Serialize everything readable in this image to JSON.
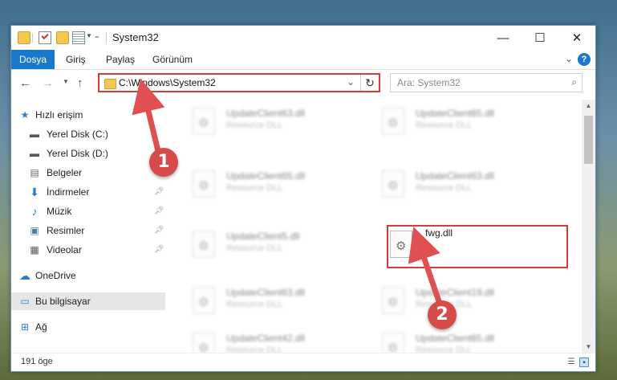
{
  "window": {
    "title": "System32",
    "minimize_glyph": "—",
    "maximize_glyph": "☐",
    "close_glyph": "✕"
  },
  "ribbon": {
    "tabs": [
      {
        "label": "Dosya"
      },
      {
        "label": "Giriş"
      },
      {
        "label": "Paylaş"
      },
      {
        "label": "Görünüm"
      }
    ],
    "help": "?"
  },
  "navbar": {
    "back": "←",
    "forward": "→",
    "up": "↑",
    "address": "C:\\Windows\\System32",
    "search_placeholder": "Ara: System32"
  },
  "sidebar": {
    "items": [
      {
        "label": "Hızlı erişim",
        "icon": "star-icon"
      },
      {
        "label": "Yerel Disk (C:)",
        "icon": "drive-icon"
      },
      {
        "label": "Yerel Disk (D:)",
        "icon": "drive-icon"
      },
      {
        "label": "Belgeler",
        "icon": "document-icon"
      },
      {
        "label": "İndirmeler",
        "icon": "download-icon"
      },
      {
        "label": "Müzik",
        "icon": "music-icon"
      },
      {
        "label": "Resimler",
        "icon": "pictures-icon"
      },
      {
        "label": "Videolar",
        "icon": "video-icon"
      },
      {
        "label": "OneDrive",
        "icon": "cloud-icon"
      },
      {
        "label": "Bu bilgisayar",
        "icon": "computer-icon"
      },
      {
        "label": "Ağ",
        "icon": "network-icon"
      }
    ]
  },
  "files": [
    {
      "name": "UpdateClient63.dll",
      "type": "Resource DLL"
    },
    {
      "name": "UpdateClient65.dll",
      "type": "Resource DLL"
    },
    {
      "name": "UpdateClient65.dll",
      "type": "Resource DLL"
    },
    {
      "name": "UpdateClient63.dll",
      "type": "Resource DLL"
    },
    {
      "name": "UpdateClient5.dll",
      "type": "Resource DLL"
    },
    {
      "name": "fwg.dll",
      "type": ""
    },
    {
      "name": "UpdateClient63.dll",
      "type": "Resource DLL"
    },
    {
      "name": "UpdateClient19.dll",
      "type": "Resource DLL"
    },
    {
      "name": "UpdateClient42.dll",
      "type": "Resource DLL"
    },
    {
      "name": "UpdateClient65.dll",
      "type": "Resource DLL"
    }
  ],
  "status": {
    "count": "191 öge"
  },
  "callouts": [
    "1",
    "2"
  ],
  "colors": {
    "accent": "#1979ca",
    "highlight": "#d63a3a"
  }
}
